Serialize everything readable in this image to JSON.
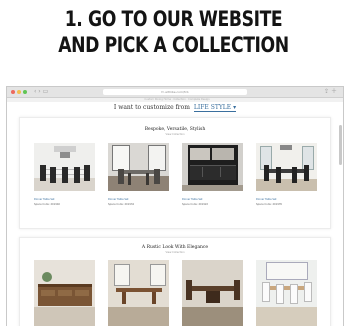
{
  "headline": {
    "line1": "1. GO TO OUR WEBSITE",
    "line2": "AND PICK A COLLECTION"
  },
  "browser": {
    "url": "fc.alltribe.com/fcb",
    "site_strip": "Custom Dining Home · Collection · Complete Design"
  },
  "customizer": {
    "prefix": "I want to customize from",
    "selected": "LIFE STYLE"
  },
  "collections": [
    {
      "title": "Bespoke, Versatile, Stylish",
      "subtitle": "View Collection",
      "items": [
        {
          "name": "Dinner Table Set",
          "code": "Space Code: 201940"
        },
        {
          "name": "Dinner Table Set",
          "code": "Space Code: 201934"
        },
        {
          "name": "Dinner Table Set",
          "code": "Space Code: 201922"
        },
        {
          "name": "Dinner Table Set",
          "code": "Space Code: 201935"
        }
      ]
    },
    {
      "title": "A Rustic Look With Elegance",
      "subtitle": "View Collection"
    }
  ],
  "colors": {
    "link": "#3a6f9e",
    "text": "#141414",
    "titlebar": "#e4e4e4"
  }
}
